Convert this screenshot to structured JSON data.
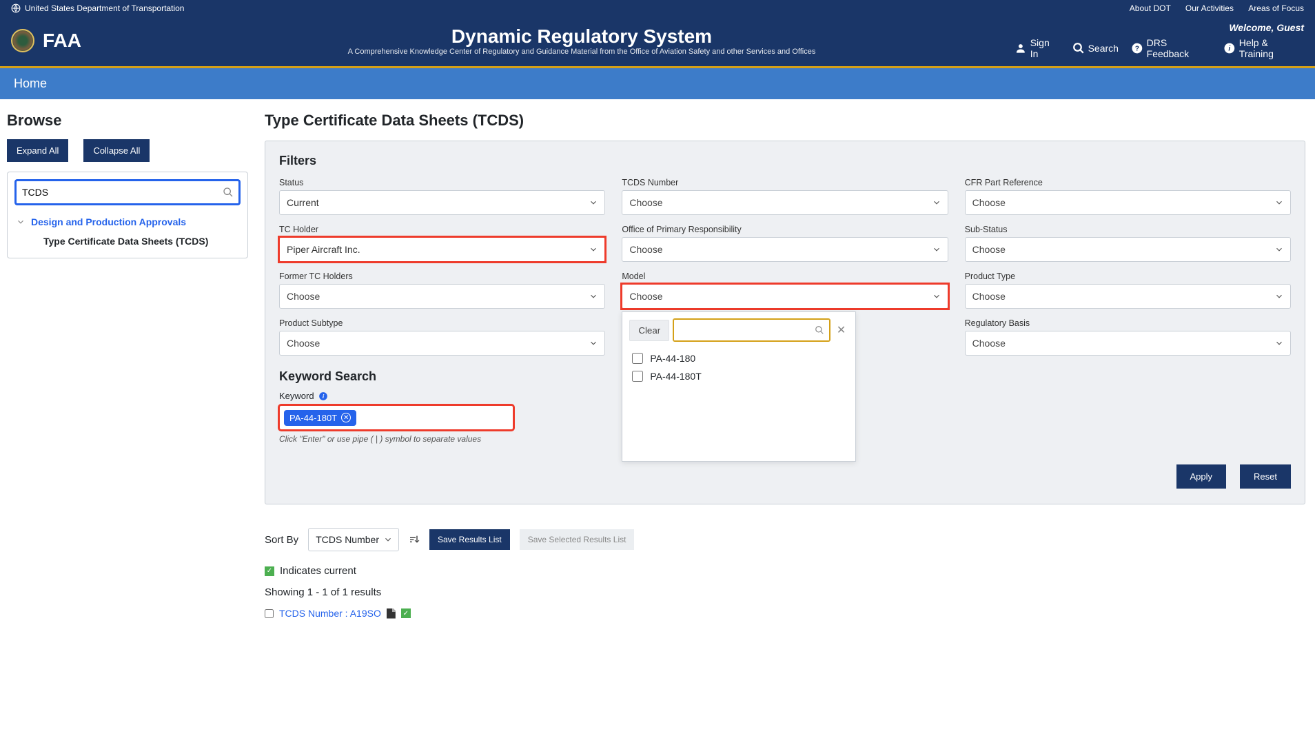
{
  "gov_bar": {
    "dept": "United States Department of Transportation",
    "links": [
      "About DOT",
      "Our Activities",
      "Areas of Focus"
    ]
  },
  "header": {
    "agency": "FAA",
    "title": "Dynamic Regulatory System",
    "subtitle": "A Comprehensive Knowledge Center of Regulatory and Guidance Material from the Office of Aviation Safety and other Services and Offices",
    "welcome": "Welcome, Guest",
    "actions": {
      "sign_in": "Sign In",
      "search": "Search",
      "feedback": "DRS Feedback",
      "help": "Help & Training"
    }
  },
  "nav": {
    "home": "Home"
  },
  "sidebar": {
    "browse": "Browse",
    "expand_all": "Expand All",
    "collapse_all": "Collapse All",
    "search_value": "TCDS",
    "tree": {
      "lvl1": "Design and Production Approvals",
      "lvl2": "Type Certificate Data Sheets (TCDS)"
    }
  },
  "main": {
    "title": "Type Certificate Data Sheets (TCDS)",
    "filters_h": "Filters",
    "filters": {
      "status": {
        "label": "Status",
        "value": "Current"
      },
      "tcds_number": {
        "label": "TCDS Number",
        "value": "Choose"
      },
      "cfr": {
        "label": "CFR Part Reference",
        "value": "Choose"
      },
      "tc_holder": {
        "label": "TC Holder",
        "value": "Piper Aircraft Inc."
      },
      "opr": {
        "label": "Office of Primary Responsibility",
        "value": "Choose"
      },
      "sub_status": {
        "label": "Sub-Status",
        "value": "Choose"
      },
      "former_tc": {
        "label": "Former TC Holders",
        "value": "Choose"
      },
      "model": {
        "label": "Model",
        "value": "Choose"
      },
      "product_type": {
        "label": "Product Type",
        "value": "Choose"
      },
      "product_subtype": {
        "label": "Product Subtype",
        "value": "Choose"
      },
      "regulatory_basis": {
        "label": "Regulatory Basis",
        "value": "Choose"
      }
    },
    "model_dropdown": {
      "clear": "Clear",
      "options": [
        "PA-44-180",
        "PA-44-180T"
      ]
    },
    "keyword": {
      "heading": "Keyword Search",
      "label": "Keyword",
      "chip": "PA-44-180T",
      "hint": "Click \"Enter\" or use pipe ( | ) symbol to separate values"
    },
    "apply": "Apply",
    "reset": "Reset",
    "sort_by_label": "Sort By",
    "sort_by_value": "TCDS Number",
    "save_list": "Save Results List",
    "save_selected": "Save Selected Results List",
    "indicates": "Indicates current",
    "showing": "Showing 1 - 1 of 1 results",
    "result_link": "TCDS Number : A19SO"
  }
}
